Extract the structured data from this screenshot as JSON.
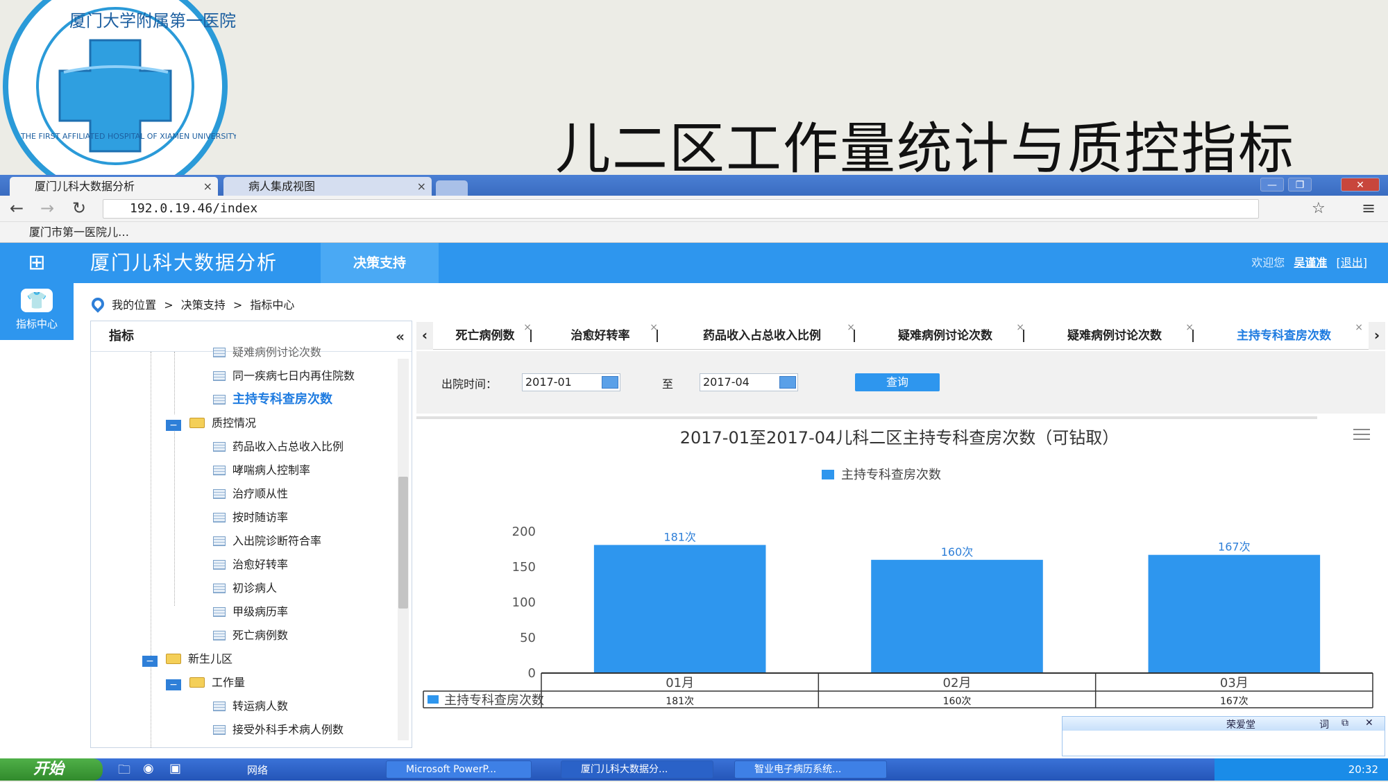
{
  "slide": {
    "title": "儿二区工作量统计与质控指标",
    "logo": {
      "ring_text_top": "厦门大学附属第一医院",
      "ring_text_bottom": "THE FIRST AFFILIATED HOSPITAL OF XIAMEN UNIVERSITY",
      "colors": {
        "ring": "#2a9ad8",
        "cross": "#2f9fe0"
      }
    }
  },
  "browser": {
    "tabs": [
      {
        "label": "厦门儿科大数据分析",
        "close": "×"
      },
      {
        "label": "病人集成视图",
        "close": "×"
      }
    ],
    "window_controls": {
      "min": "—",
      "max": "❐",
      "close": "✕"
    },
    "url": "192.0.19.46/index",
    "bookmark": "厦门市第一医院儿…"
  },
  "app": {
    "title": "厦门儿科大数据分析",
    "nav": {
      "decision": "决策支持"
    },
    "welcome": "欢迎您",
    "user": "吴谨准",
    "logout": "[退出]",
    "rail": {
      "label": "指标中心"
    },
    "breadcrumb": [
      "我的位置",
      ">",
      "决策支持",
      ">",
      "指标中心"
    ],
    "accent": "#2e96ee"
  },
  "tree": {
    "header": "指标",
    "collapse": "«",
    "items": [
      {
        "label": "疑难病例讨论次数"
      },
      {
        "label": "同一疾病七日内再住院数"
      },
      {
        "label": "主持专科查房次数"
      },
      {
        "label": "质控情况"
      },
      {
        "label": "药品收入占总收入比例"
      },
      {
        "label": "哮喘病人控制率"
      },
      {
        "label": "治疗顺从性"
      },
      {
        "label": "按时随访率"
      },
      {
        "label": "入出院诊断符合率"
      },
      {
        "label": "治愈好转率"
      },
      {
        "label": "初诊病人"
      },
      {
        "label": "甲级病历率"
      },
      {
        "label": "死亡病例数"
      },
      {
        "label": "新生儿区"
      },
      {
        "label": "工作量"
      },
      {
        "label": "转运病人数"
      },
      {
        "label": "接受外科手术病人例数"
      }
    ]
  },
  "content_tabs": [
    {
      "label": "死亡病例数",
      "close": "×"
    },
    {
      "label": "治愈好转率",
      "close": "×"
    },
    {
      "label": "药品收入占总收入比例",
      "close": "×"
    },
    {
      "label": "疑难病例讨论次数",
      "close": "×"
    },
    {
      "label": "疑难病例讨论次数",
      "close": "×"
    },
    {
      "label": "主持专科查房次数",
      "close": "×"
    }
  ],
  "filter": {
    "label": "出院时间：",
    "from": "2017-01",
    "to_label": "至",
    "to": "2017-04",
    "query": "查询"
  },
  "chart_data": {
    "type": "bar",
    "title": "2017-01至2017-04儿科二区主持专科查房次数（可钻取）",
    "categories": [
      "01月",
      "02月",
      "03月"
    ],
    "series": [
      {
        "name": "主持专科查房次数",
        "values": [
          181,
          160,
          167
        ],
        "color": "#2e96ee"
      }
    ],
    "data_labels": [
      "181次",
      "160次",
      "167次"
    ],
    "yticks": [
      "0",
      "50",
      "100",
      "150",
      "200"
    ],
    "ylim": [
      0,
      200
    ],
    "legend": "top-center",
    "data_table": {
      "row_label": "主持专科查房次数",
      "cells": [
        "181次",
        "160次",
        "167次"
      ]
    }
  },
  "taskbar": {
    "start": "开始",
    "network": "网络",
    "tasks": [
      {
        "label": "Microsoft PowerP..."
      },
      {
        "label": "厦门儿科大数据分..."
      },
      {
        "label": "智业电子病历系统..."
      }
    ],
    "clock": "20:32",
    "ime": {
      "name": "荣爱堂",
      "btn1": "词",
      "btn2": "⧉",
      "btn3": "✕"
    }
  }
}
